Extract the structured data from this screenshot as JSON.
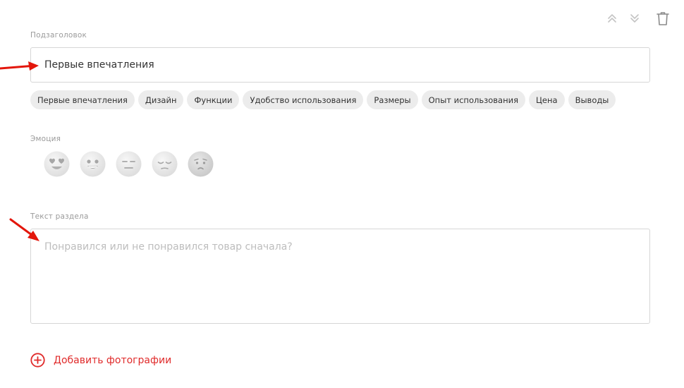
{
  "subtitle": {
    "label": "Подзаголовок",
    "value": "Первые впечатления"
  },
  "chips": [
    "Первые впечатления",
    "Дизайн",
    "Функции",
    "Удобство использования",
    "Размеры",
    "Опыт использования",
    "Цена",
    "Выводы"
  ],
  "emotion": {
    "label": "Эмоция",
    "faces": [
      "heart-eyes",
      "grinning",
      "neutral",
      "relieved",
      "sad"
    ]
  },
  "section_text": {
    "label": "Текст раздела",
    "placeholder": "Понравился или не понравился товар сначала?"
  },
  "add_photos": {
    "label": "Добавить фотографии"
  },
  "colors": {
    "accent": "#e02b2b",
    "chip_bg": "#ececec",
    "border": "#d6d6d6",
    "label": "#9a9a9a",
    "placeholder": "#bdbdbd",
    "annotation_arrow": "#e3160b"
  },
  "icons": {
    "move_up": "chevron-double-up-icon",
    "move_down": "chevron-double-down-icon",
    "delete": "trash-icon",
    "add": "plus-circle-icon"
  }
}
